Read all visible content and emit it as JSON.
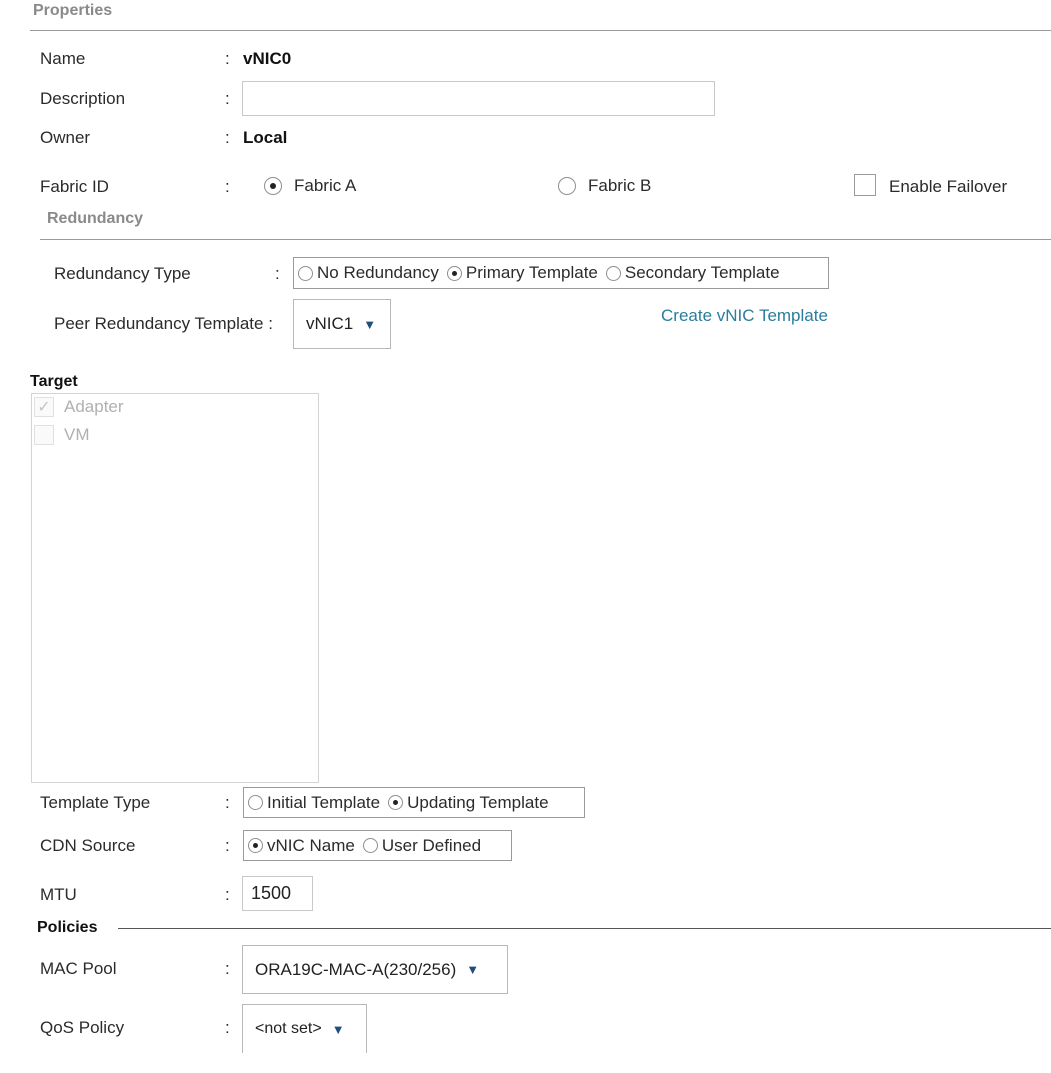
{
  "properties": {
    "header": "Properties",
    "name_label": "Name",
    "name_value": "vNIC0",
    "description_label": "Description",
    "description_value": "",
    "owner_label": "Owner",
    "owner_value": "Local",
    "fabric_label": "Fabric ID",
    "fabric_a": "Fabric A",
    "fabric_b": "Fabric B",
    "fabric_selected": "Fabric A",
    "enable_failover": "Enable Failover",
    "enable_failover_checked": false,
    "colon": ":"
  },
  "redundancy": {
    "header": "Redundancy",
    "type_label": "Redundancy Type",
    "options": [
      "No Redundancy",
      "Primary Template",
      "Secondary Template"
    ],
    "selected": "Primary Template",
    "peer_label": "Peer Redundancy Template :",
    "peer_value": "vNIC1",
    "create_link": "Create vNIC Template"
  },
  "target": {
    "header": "Target",
    "items": [
      {
        "label": "Adapter",
        "checked": true
      },
      {
        "label": "VM",
        "checked": false
      }
    ]
  },
  "template": {
    "type_label": "Template Type",
    "type_options": [
      "Initial Template",
      "Updating Template"
    ],
    "type_selected": "Updating Template",
    "cdn_label": "CDN Source",
    "cdn_options": [
      "vNIC Name",
      "User Defined"
    ],
    "cdn_selected": "vNIC Name",
    "mtu_label": "MTU",
    "mtu_value": "1500"
  },
  "policies": {
    "header": "Policies",
    "mac_label": "MAC Pool",
    "mac_value": "ORA19C-MAC-A(230/256)",
    "qos_label": "QoS Policy",
    "qos_value": "<not set>"
  },
  "icons": {
    "caret": "caret-down-icon",
    "check": "checkmark-icon"
  }
}
